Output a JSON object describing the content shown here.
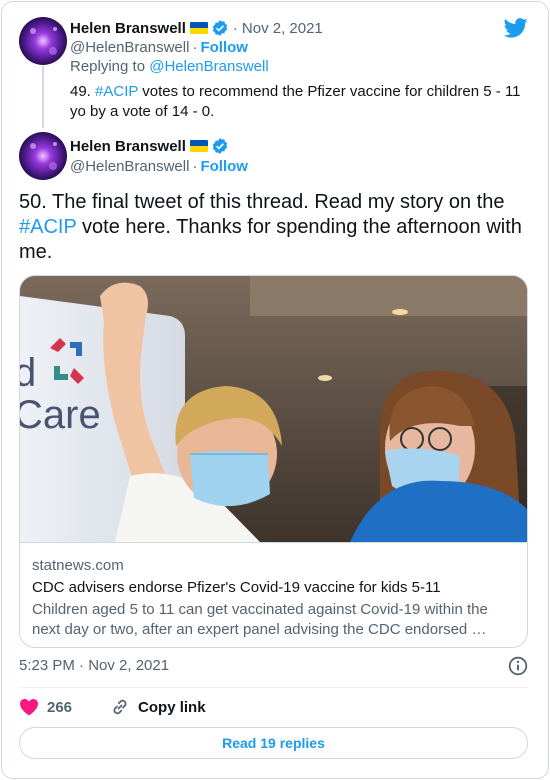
{
  "tweet1": {
    "name": "Helen Branswell",
    "handle": "@HelenBranswell",
    "date": "Nov 2, 2021",
    "follow": "Follow",
    "replying_prefix": "Replying to ",
    "replying_handle": "@HelenBranswell",
    "text_prefix": "49. ",
    "hashtag": "#ACIP",
    "text_suffix": " votes to recommend the Pfizer vaccine for children 5 - 11 yo by a vote of 14 - 0."
  },
  "tweet2": {
    "name": "Helen Branswell",
    "handle": "@HelenBranswell",
    "follow": "Follow",
    "text_prefix": "50. The final tweet of this thread. Read my story on the ",
    "hashtag": "#ACIP",
    "text_suffix": " vote here. Thanks for spending the afternoon with me."
  },
  "card": {
    "domain": "statnews.com",
    "title": "CDC advisers endorse Pfizer's Covid-19 vaccine for kids 5-11",
    "description": "Children aged 5 to 11 can get vaccinated against Covid-19 within the next day or two, after an expert panel advising the CDC endorsed …"
  },
  "timestamp": "5:23 PM · Nov 2, 2021",
  "actions": {
    "likes": "266",
    "copy_link": "Copy link"
  },
  "read_replies": "Read 19 replies",
  "colors": {
    "accent": "#1d9bf0",
    "like": "#f91880",
    "secondary_text": "#536471"
  },
  "icons": {
    "brand": "twitter-bird-icon",
    "verified": "verified-badge-icon",
    "flag": "ukraine-flag-icon",
    "like": "heart-icon",
    "copy": "link-icon",
    "info": "info-icon"
  }
}
